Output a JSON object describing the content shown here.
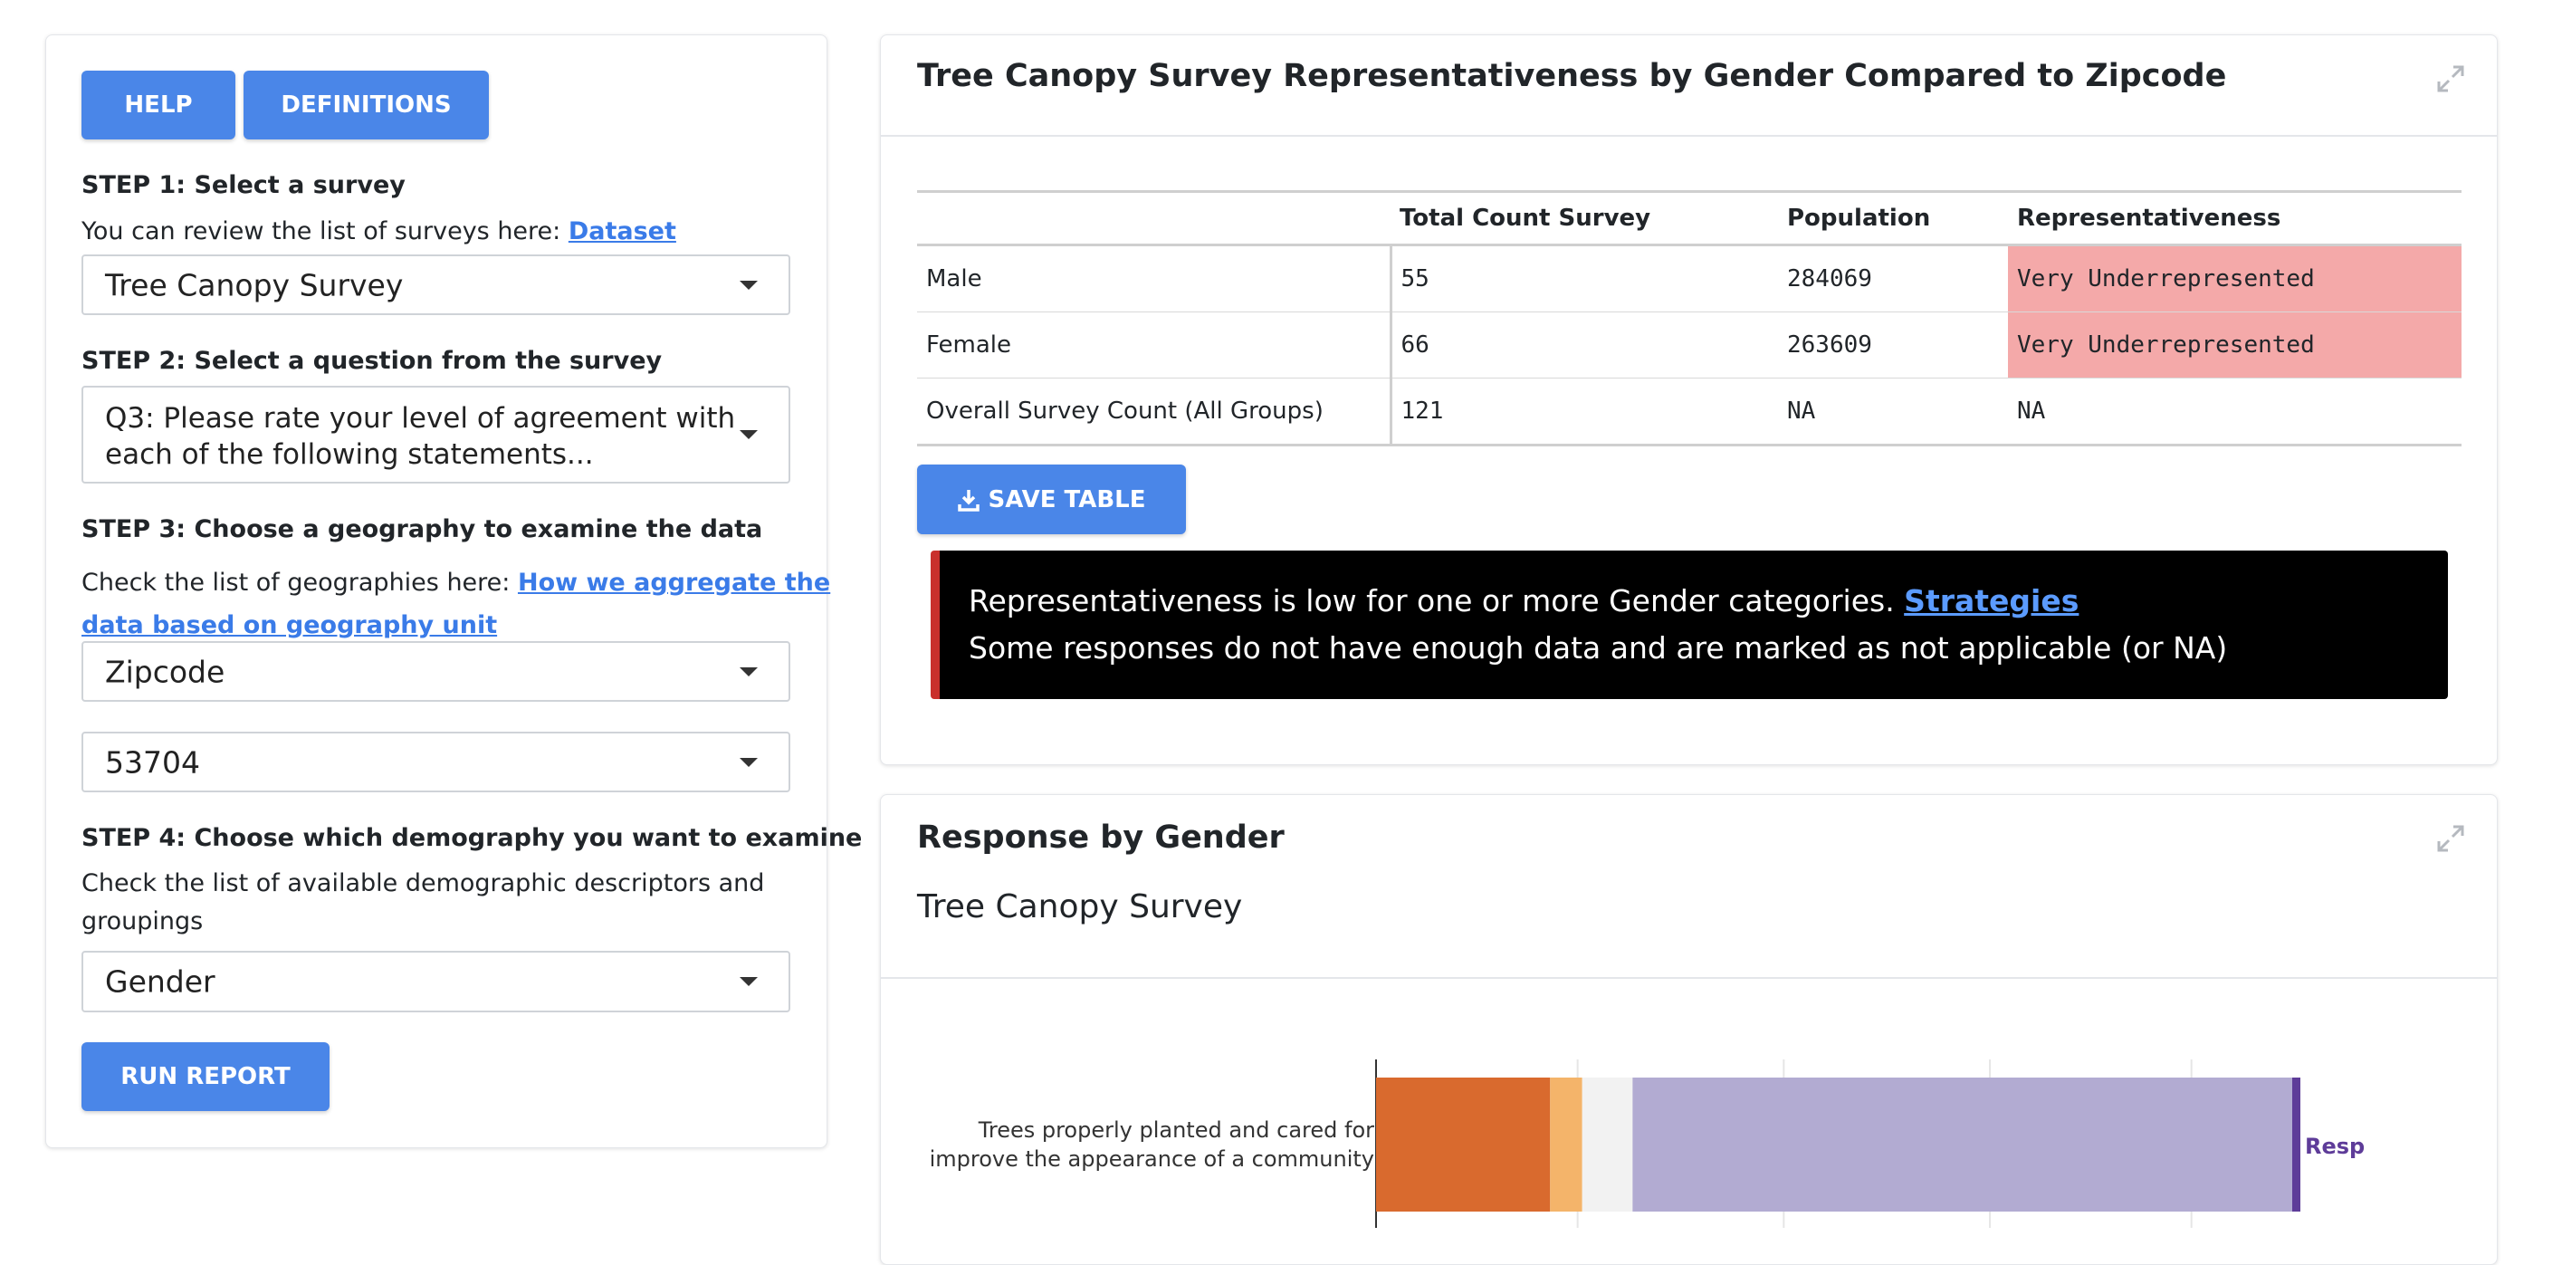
{
  "sidebar": {
    "help_label": "HELP",
    "definitions_label": "DEFINITIONS",
    "step1": {
      "title": "STEP 1: Select a survey",
      "text": "You can review the list of surveys here: ",
      "link": "Dataset",
      "selected": "Tree Canopy Survey"
    },
    "step2": {
      "title": "STEP 2: Select a question from the survey",
      "selected_line1": "Q3: Please rate your level of agreement with",
      "selected_line2": "each of the following statements..."
    },
    "step3": {
      "title": "STEP 3: Choose a geography to examine the data",
      "text": "Check the list of geographies here: ",
      "link_line1": "How we aggregate the",
      "link_line2": "data based on geography unit",
      "geography": "Zipcode",
      "zipcode": "53704"
    },
    "step4": {
      "title": "STEP 4: Choose which demography you want to examine",
      "text_line1": "Check the list of available demographic descriptors and",
      "text_line2": "groupings",
      "selected": "Gender"
    },
    "run_label": "RUN REPORT"
  },
  "table_card": {
    "title": "Tree Canopy Survey Representativeness by Gender Compared to Zipcode",
    "columns": [
      "",
      "Total Count Survey",
      "Population",
      "Representativeness"
    ],
    "rows": [
      [
        "Male",
        "55",
        "284069",
        "Very Underrepresented"
      ],
      [
        "Female",
        "66",
        "263609",
        "Very Underrepresented"
      ],
      [
        "Overall Survey Count (All Groups)",
        "121",
        "NA",
        "NA"
      ]
    ],
    "save_label": "SAVE TABLE",
    "alert_line1": "Representativeness is low for one or more Gender categories. ",
    "alert_link": "Strategies",
    "alert_line2": "Some responses do not have enough data and are marked as not applicable (or NA)",
    "underrepresented_color": "#f4a9a9"
  },
  "response_card": {
    "title": "Response by Gender",
    "subtitle": "Tree Canopy Survey"
  },
  "chart_data": {
    "type": "bar",
    "orientation": "horizontal-stacked",
    "categories": [
      "Trees properly planted and cared for improve the appearance of a community"
    ],
    "category_line1": "Trees properly planted and cared for",
    "category_line2": "improve the appearance of a community",
    "series": [
      {
        "values": [
          0.19
        ],
        "color": "#d96a2e"
      },
      {
        "values": [
          0.035
        ],
        "color": "#f4b46a"
      },
      {
        "values": [
          0.055
        ],
        "color": "#f2f2f2"
      },
      {
        "values": [
          0.72
        ],
        "color": "#b2abd2"
      }
    ],
    "right_label": "Resp",
    "xlim": [
      0,
      1
    ],
    "grid": true
  }
}
